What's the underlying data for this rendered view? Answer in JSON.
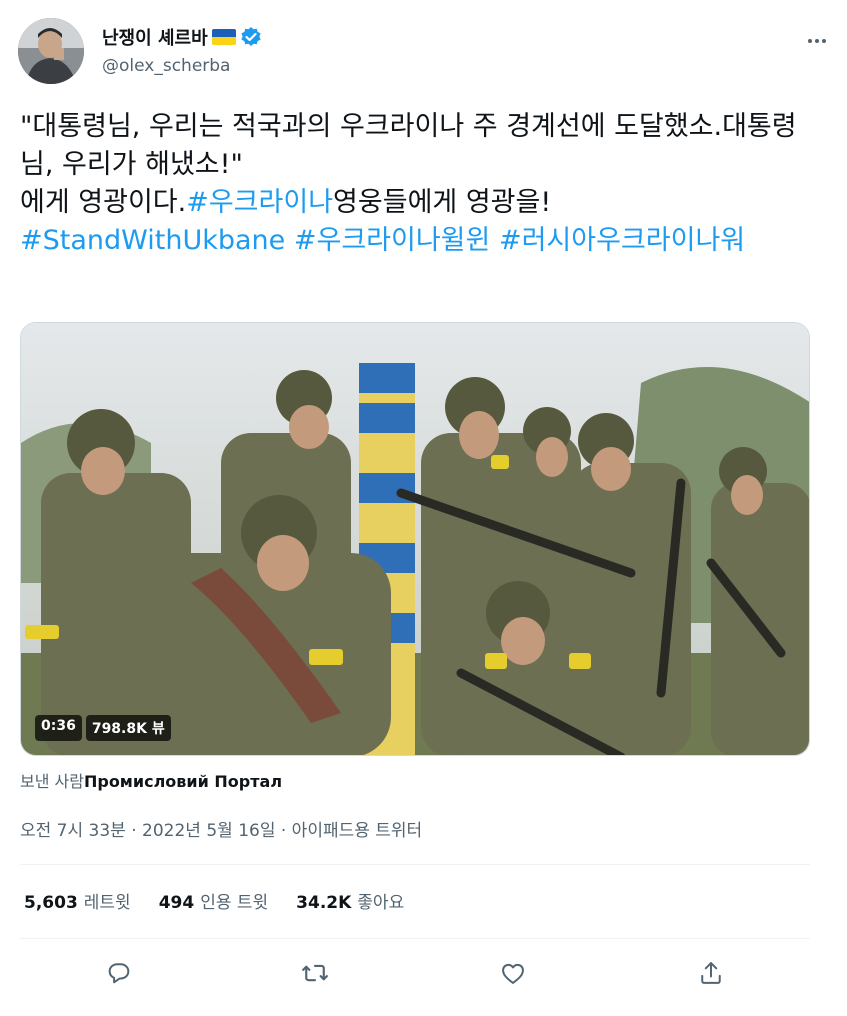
{
  "author": {
    "display_name": "난쟁이 셰르바",
    "handle": "@olex_scherba",
    "verified_icon": "verified-badge-icon",
    "flag_colors": [
      "#1c5fb8",
      "#f7d417"
    ]
  },
  "tweet": {
    "segments": [
      {
        "text": "\"대통령님, 우리는 적국과의 우크라이나 주 경계선에 도달했소.대통령님, 우리가 해냈소!\"\n에게 영광이다.",
        "type": "text"
      },
      {
        "text": "#우크라이나",
        "type": "tag"
      },
      {
        "text": "영웅들에게 영광을!\n",
        "type": "text"
      },
      {
        "text": "#StandWithUkbane",
        "type": "tag"
      },
      {
        "text": " ",
        "type": "text"
      },
      {
        "text": "#우크라이나윌윈",
        "type": "tag"
      },
      {
        "text": " ",
        "type": "text"
      },
      {
        "text": "#러시아우크라이나워",
        "type": "tag"
      }
    ]
  },
  "media": {
    "duration": "0:36",
    "views": "798.8K 뷰"
  },
  "from": {
    "prefix": "보낸 사람",
    "source": "Промисловий Портал"
  },
  "meta": "오전 7시 33분 · 2022년 5월 16일 · 아이패드용 트위터",
  "stats": [
    {
      "num": "5,603",
      "label": "레트윗"
    },
    {
      "num": "494",
      "label": "인용 트윗"
    },
    {
      "num": "34.2K",
      "label": "좋아요"
    }
  ],
  "actions": [
    "reply-icon",
    "retweet-icon",
    "like-icon",
    "share-icon"
  ],
  "colors": {
    "accent": "#1d9bf0",
    "secondary": "#536471",
    "text": "#0f1419"
  }
}
